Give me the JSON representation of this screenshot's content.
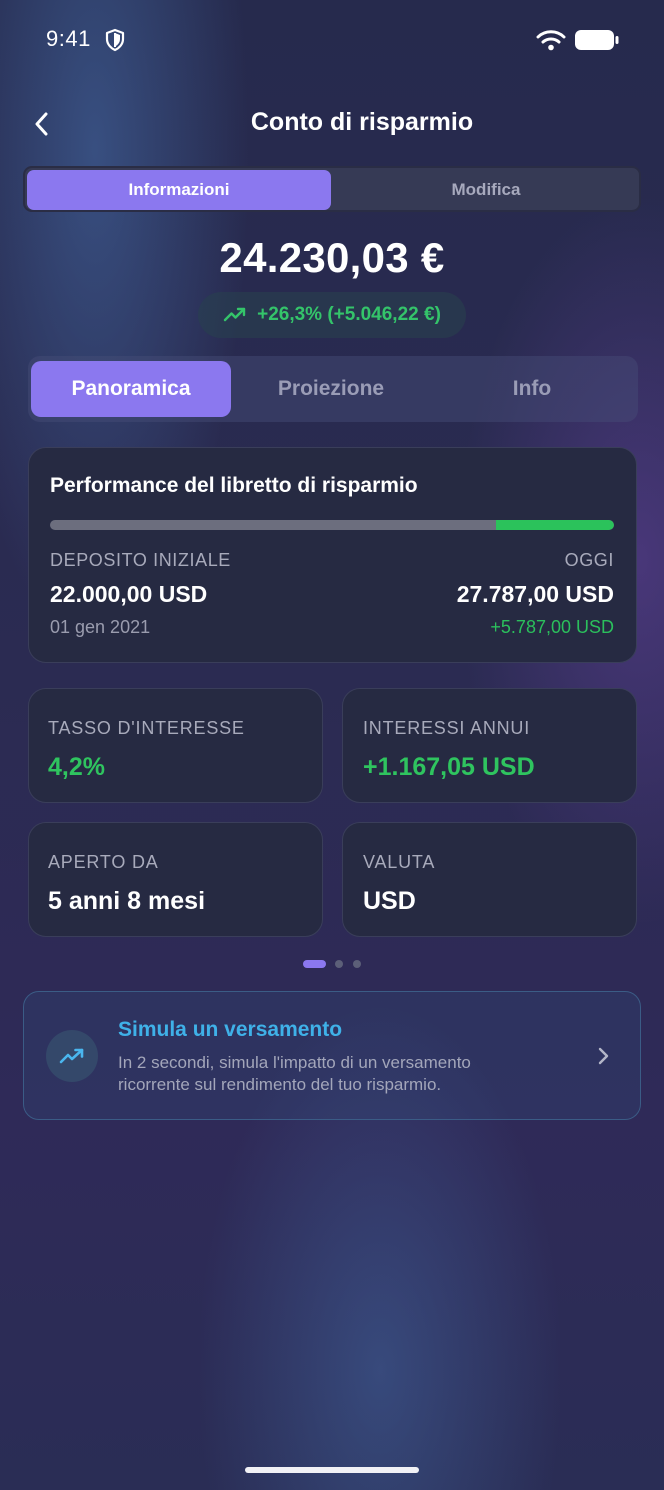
{
  "status_bar": {
    "time": "9:41",
    "shield_icon": "shield-icon",
    "wifi_icon": "wifi-icon",
    "battery_icon": "battery-icon"
  },
  "header": {
    "title": "Conto di risparmio",
    "back_icon": "chevron-left-icon"
  },
  "segmented": {
    "items": [
      "Informazioni",
      "Modifica"
    ],
    "selected": "Informazioni"
  },
  "balance": {
    "amount": "24.230,03 €",
    "change": "+26,3% (+5.046,22 €)",
    "trend_icon": "trending-up-icon"
  },
  "tabs": {
    "items": [
      "Panoramica",
      "Proiezione",
      "Info"
    ],
    "selected": "Panoramica"
  },
  "performance": {
    "title": "Performance del libretto di risparmio",
    "progress_initial_fraction": 0.79,
    "initial_label": "DEPOSITO INIZIALE",
    "initial_value": "22.000,00 USD",
    "initial_date": "01 gen 2021",
    "today_label": "OGGI",
    "today_value": "27.787,00 USD",
    "today_change": "+5.787,00 USD"
  },
  "stats": [
    {
      "label": "TASSO D'INTERESSE",
      "value": "4,2%"
    },
    {
      "label": "INTERESSI ANNUI",
      "value": "+1.167,05 USD"
    },
    {
      "label": "APERTO DA",
      "value": "5 anni 8 mesi"
    },
    {
      "label": "VALUTA",
      "value": "USD"
    }
  ],
  "pager": {
    "count": 3,
    "active": 0
  },
  "simulate": {
    "title": "Simula un versamento",
    "description": "In 2 secondi, simula l'impatto di un versamento ricorrente sul rendimento del tuo risparmio.",
    "icon": "trending-up-icon",
    "chevron_icon": "chevron-right-icon"
  },
  "colors": {
    "accent": "#8b78ef",
    "positive": "#2fc45f",
    "link": "#3fb1e8"
  }
}
